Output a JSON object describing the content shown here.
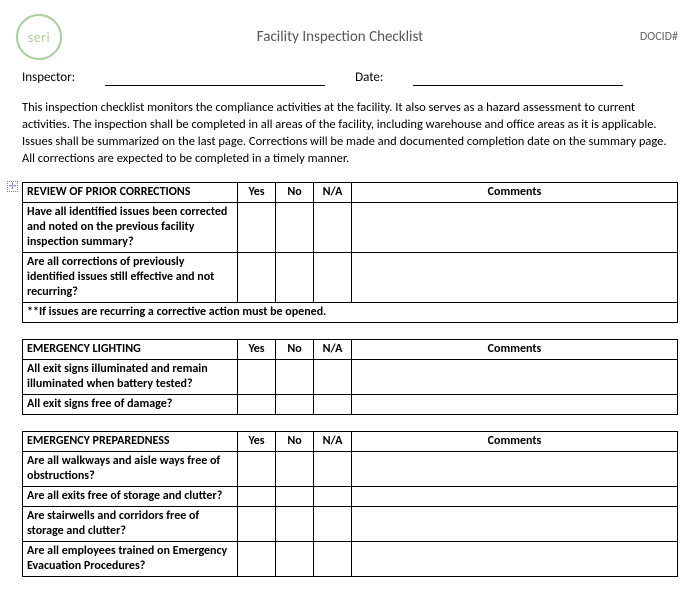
{
  "header": {
    "logo_text": "seri",
    "title": "Facility Inspection Checklist",
    "docid_label": "DOCID#"
  },
  "meta": {
    "inspector_label": "Inspector:",
    "inspector_value": "",
    "date_label": "Date:",
    "date_value": ""
  },
  "description": "This inspection checklist monitors the compliance activities at the facility.  It also serves as a hazard assessment to current activities.  The inspection shall be completed in all areas of the facility, including warehouse and office areas as it is applicable.  Issues shall be summarized on the last page.  Corrections will be made and documented completion date on the summary page.   All corrections are expected to be completed in a timely manner.",
  "columns": {
    "yes": "Yes",
    "no": "No",
    "na": "N/A",
    "comments": "Comments"
  },
  "sections": [
    {
      "heading": "REVIEW OF PRIOR CORRECTIONS",
      "rows": [
        {
          "q": "Have all identified issues been corrected and noted on the previous facility inspection summary?"
        },
        {
          "q": "Are all corrections of previously identified issues still effective and not recurring?"
        }
      ],
      "note": "**If issues are recurring a corrective action must be opened."
    },
    {
      "heading": "EMERGENCY LIGHTING",
      "rows": [
        {
          "q": "All exit signs illuminated and remain illuminated when battery tested?"
        },
        {
          "q": "All exit signs free of damage?"
        }
      ]
    },
    {
      "heading": "EMERGENCY PREPAREDNESS",
      "rows": [
        {
          "q": "Are all walkways and aisle ways free of obstructions?"
        },
        {
          "q": "Are all exits free of storage and clutter?"
        },
        {
          "q": "Are stairwells and corridors free of storage and clutter?"
        },
        {
          "q": "Are all employees trained on Emergency Evacuation Procedures?"
        }
      ]
    }
  ]
}
